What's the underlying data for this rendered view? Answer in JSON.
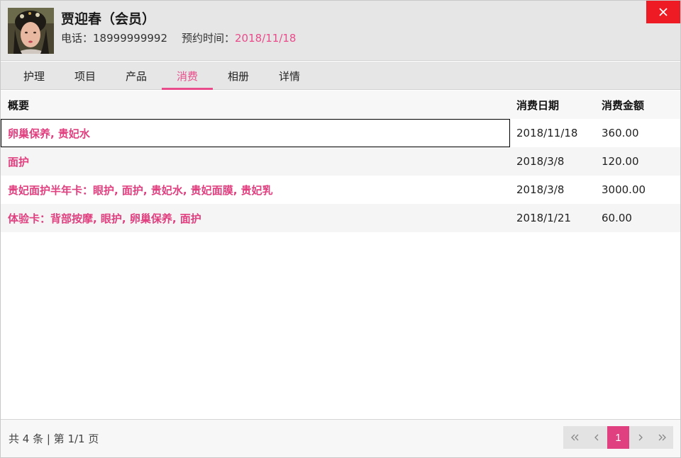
{
  "header": {
    "name": "贾迎春（会员）",
    "phone_label": "电话：",
    "phone": "18999999992",
    "appt_label": "预约时间：",
    "appt_date": "2018/11/18"
  },
  "tabs": [
    {
      "label": "护理"
    },
    {
      "label": "项目"
    },
    {
      "label": "产品"
    },
    {
      "label": "消费",
      "active": true
    },
    {
      "label": "相册"
    },
    {
      "label": "详情"
    }
  ],
  "table": {
    "columns": [
      "概要",
      "消费日期",
      "消费金额"
    ],
    "rows": [
      {
        "summary": "卵巢保养, 贵妃水",
        "date": "2018/11/18",
        "amount": "360.00"
      },
      {
        "summary": "面护",
        "date": "2018/3/8",
        "amount": "120.00"
      },
      {
        "summary": "贵妃面护半年卡：眼护, 面护, 贵妃水, 贵妃面膜, 贵妃乳",
        "date": "2018/3/8",
        "amount": "3000.00"
      },
      {
        "summary": "体验卡：背部按摩, 眼护, 卵巢保养, 面护",
        "date": "2018/1/21",
        "amount": "60.00"
      }
    ]
  },
  "footer": {
    "count_text": "共 4 条 | 第 1/1 页",
    "current_page": "1"
  },
  "colors": {
    "accent": "#e84c8a",
    "close": "#ee1b24"
  }
}
